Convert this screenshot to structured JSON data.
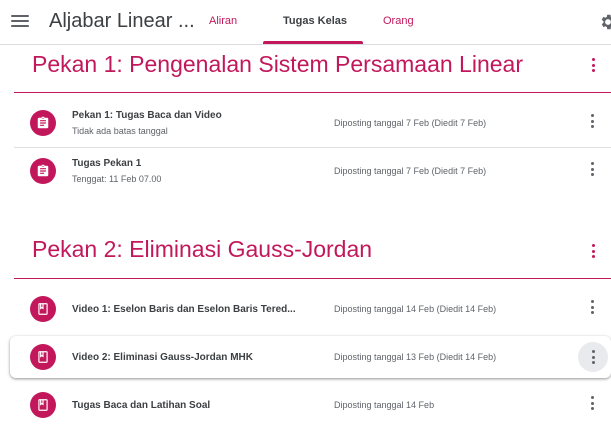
{
  "header": {
    "title": "Aljabar Linear ...",
    "tabs": [
      {
        "label": "Aliran"
      },
      {
        "label": "Tugas Kelas"
      },
      {
        "label": "Orang"
      }
    ]
  },
  "colors": {
    "accent": "#c2185b",
    "text": "#3c4043",
    "muted": "#5f6368"
  },
  "topics": [
    {
      "title": "Pekan 1: Pengenalan Sistem Persamaan Linear",
      "items": [
        {
          "icon": "assignment-icon",
          "title": "Pekan 1: Tugas Baca dan Video",
          "subtitle": "Tidak ada batas tanggal",
          "posted": "Diposting tanggal 7 Feb (Diedit 7 Feb)"
        },
        {
          "icon": "assignment-icon",
          "title": "Tugas Pekan 1",
          "subtitle": "Tenggat: 11 Feb 07.00",
          "posted": "Diposting tanggal 7 Feb (Diedit 7 Feb)"
        }
      ]
    },
    {
      "title": "Pekan 2: Eliminasi Gauss-Jordan",
      "items": [
        {
          "icon": "material-icon",
          "title": "Video 1: Eselon Baris dan Eselon Baris Tered...",
          "posted": "Diposting tanggal 14 Feb (Diedit 14 Feb)"
        },
        {
          "icon": "material-icon",
          "title": "Video 2: Eliminasi Gauss-Jordan MHK",
          "posted": "Diposting tanggal 13 Feb (Diedit 14 Feb)"
        },
        {
          "icon": "material-icon",
          "title": "Tugas Baca dan Latihan Soal",
          "posted": "Diposting tanggal 14 Feb"
        }
      ]
    }
  ]
}
